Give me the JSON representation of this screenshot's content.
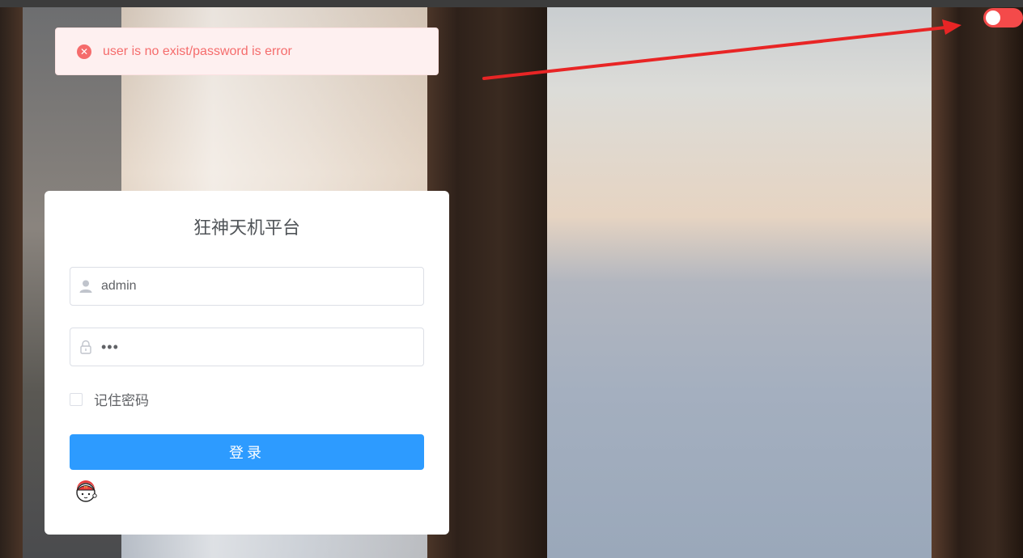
{
  "alert": {
    "message": "user is no exist/password is error",
    "type": "error",
    "color": "#f56c6c"
  },
  "toggle": {
    "state": "on",
    "color": "#f44a4a"
  },
  "login": {
    "title": "狂神天机平台",
    "username": {
      "value": "admin",
      "icon": "user-icon"
    },
    "password": {
      "value": "•••",
      "icon": "lock-icon"
    },
    "remember_label": "记住密码",
    "remember_checked": false,
    "submit_label": "登录",
    "submit_color": "#2d9bff",
    "mascot_icon": "mascot-icon"
  },
  "annotation_arrow_color": "#e82525"
}
